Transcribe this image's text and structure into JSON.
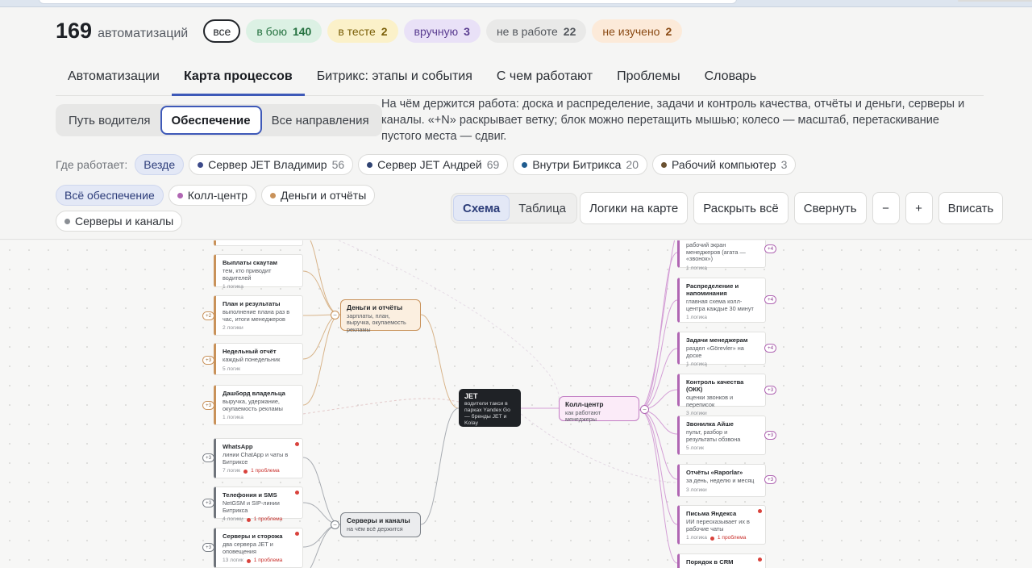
{
  "summary": {
    "count": "169",
    "count_label": "автоматизаций",
    "filters": [
      {
        "label": "все",
        "num": ""
      },
      {
        "label": "в бою",
        "num": "140"
      },
      {
        "label": "в тесте",
        "num": "2"
      },
      {
        "label": "вручную",
        "num": "3"
      },
      {
        "label": "не в работе",
        "num": "22"
      },
      {
        "label": "не изучено",
        "num": "2"
      }
    ]
  },
  "tabs": [
    "Автоматизации",
    "Карта процессов",
    "Битрикс: этапы и события",
    "С чем работают",
    "Проблемы",
    "Словарь"
  ],
  "segments": [
    "Путь водителя",
    "Обеспечение",
    "Все направления"
  ],
  "description": "На чём держится работа: доска и распределение, задачи и контроль качества, отчёты и деньги, серверы и каналы. «+N» раскрывает ветку; блок можно перетащить мышью; колесо — масштаб, перетаскивание пустого места — сдвиг.",
  "where": {
    "label": "Где работает:",
    "chips": [
      {
        "label": "Везде",
        "num": ""
      },
      {
        "label": "Сервер JET Владимир",
        "num": "56",
        "color": "#3c4a8a"
      },
      {
        "label": "Сервер JET Андрей",
        "num": "69",
        "color": "#2f4372"
      },
      {
        "label": "Внутри Битрикса",
        "num": "20",
        "color": "#1f5c8f"
      },
      {
        "label": "Рабочий компьютер",
        "num": "3",
        "color": "#6a5130"
      }
    ]
  },
  "supply_filters": [
    {
      "label": "Всё обеспечение"
    },
    {
      "label": "Колл-центр",
      "color": "#b066b3"
    },
    {
      "label": "Деньги и отчёты",
      "color": "#c9925a"
    },
    {
      "label": "Серверы и каналы",
      "color": "#8a8e94"
    }
  ],
  "view": [
    "Схема",
    "Таблица"
  ],
  "actions": {
    "logic": "Логики на карте",
    "expand": "Раскрыть всё",
    "collapse": "Свернуть",
    "minus": "−",
    "plus": "+",
    "fit": "Вписать"
  },
  "map": {
    "root": {
      "title": "JET",
      "desc": "водители такси в парках Yandex Go — бренды JET и Kolay"
    },
    "hubs": {
      "money": {
        "title": "Деньги и отчёты",
        "desc": "зарплаты, план, выручка, окупаемость рекламы"
      },
      "servers": {
        "title": "Серверы и каналы",
        "desc": "на чём всё держится"
      },
      "call": {
        "title": "Колл-центр",
        "desc": "как работают менеджеры"
      }
    },
    "money_nodes": [
      {
        "title": "Выплаты скаутам",
        "desc": "тем, кто приводит водителей",
        "meta": "1 логика",
        "plus": ""
      },
      {
        "title": "План и результаты",
        "desc": "выполнение плана раз в час, итоги менеджеров",
        "meta": "2 логики",
        "plus": "+2"
      },
      {
        "title": "Недельный отчёт",
        "desc": "каждый понедельник",
        "meta": "5 логик",
        "plus": "+3"
      },
      {
        "title": "Дашборд владельца",
        "desc": "выручка, удержание, окупаемость рекламы",
        "meta": "1 логика",
        "plus": "+3"
      }
    ],
    "server_nodes": [
      {
        "title": "WhatsApp",
        "desc": "линии ChatApp и чаты в Битриксе",
        "meta": "7 логик",
        "problem": "1 проблема",
        "plus": "+3"
      },
      {
        "title": "Телефония и SMS",
        "desc": "NetGSM и SIP-линии Битрикса",
        "meta": "4 логики",
        "problem": "1 проблема",
        "plus": "+3"
      },
      {
        "title": "Серверы и сторожа",
        "desc": "два сервера JET и оповещения",
        "meta": "13 логик",
        "problem": "1 проблема",
        "plus": "+3"
      }
    ],
    "call_nodes": [
      {
        "title": "",
        "desc": "рабочий экран менеджеров (агата — «звонок»)",
        "meta": "1 логика",
        "problem": "",
        "plus": "+4"
      },
      {
        "title": "Распределение и напоминания",
        "desc": "главная схема колл-центра каждые 30 минут",
        "meta": "1 логика",
        "problem": "",
        "plus": "+4"
      },
      {
        "title": "Задачи менеджерам",
        "desc": "раздел «Görevler» на доске",
        "meta": "1 логика",
        "problem": "",
        "plus": "+4"
      },
      {
        "title": "Контроль качества (ОКК)",
        "desc": "оценки звонков и переписок",
        "meta": "3 логики",
        "problem": "",
        "plus": "+3"
      },
      {
        "title": "Звонилка Айше",
        "desc": "пульт, разбор и результаты обзвона",
        "meta": "5 логик",
        "problem": "",
        "plus": "+3"
      },
      {
        "title": "Отчёты «Raporlar»",
        "desc": "за день, неделю и месяц",
        "meta": "3 логики",
        "problem": "",
        "plus": "+3"
      },
      {
        "title": "Письма Яндекса",
        "desc": "ИИ пересказывает их в рабочие чаты",
        "meta": "1 логика",
        "problem": "1 проблема",
        "plus": ""
      },
      {
        "title": "Порядок в CRM",
        "desc": "",
        "meta": "",
        "problem": "",
        "plus": ""
      }
    ]
  }
}
